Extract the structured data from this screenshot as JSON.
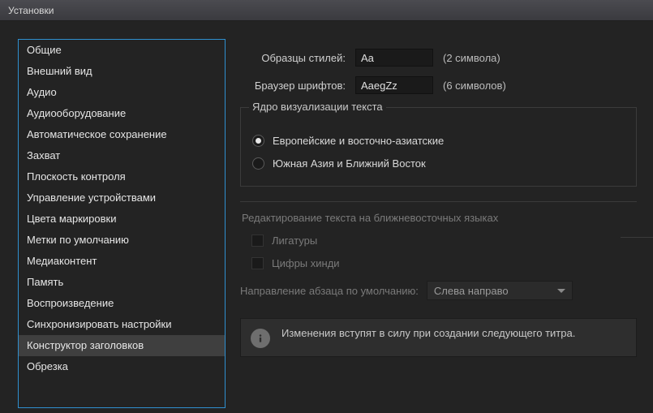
{
  "window": {
    "title": "Установки"
  },
  "sidebar": {
    "items": [
      "Общие",
      "Внешний вид",
      "Аудио",
      "Аудиооборудование",
      "Автоматическое сохранение",
      "Захват",
      "Плоскость контроля",
      "Управление устройствами",
      "Цвета маркировки",
      "Метки по умолчанию",
      "Медиаконтент",
      "Память",
      "Воспроизведение",
      "Синхронизировать настройки",
      "Конструктор заголовков",
      "Обрезка"
    ],
    "selectedIndex": 14
  },
  "main": {
    "styleSamples": {
      "label": "Образцы стилей:",
      "value": "Aa",
      "hint": "(2 символа)"
    },
    "fontBrowser": {
      "label": "Браузер шрифтов:",
      "value": "AaegZz",
      "hint": "(6 символов)"
    },
    "renderCore": {
      "title": "Ядро визуализации текста",
      "options": [
        "Европейские и восточно-азиатские",
        "Южная Азия и Ближний Восток"
      ],
      "selected": 0
    },
    "meEditing": {
      "title": "Редактирование текста на ближневосточных языках",
      "ligatures": "Лигатуры",
      "hindiDigits": "Цифры хинди",
      "paraDirLabel": "Направление абзаца по умолчанию:",
      "paraDirValue": "Слева направо"
    },
    "info": "Изменения вступят в силу при создании следующего титра."
  }
}
